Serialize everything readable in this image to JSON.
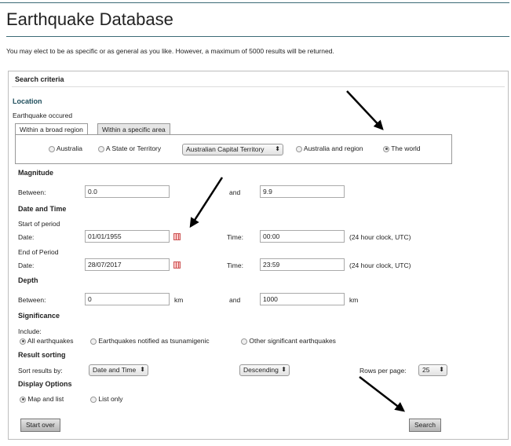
{
  "page": {
    "title": "Earthquake Database",
    "intro": "You may elect to be as specific or as general as you like. However, a maximum of 5000 results will be returned."
  },
  "form": {
    "panel_title": "Search criteria",
    "location": {
      "heading": "Location",
      "occurred_label": "Earthquake occured",
      "tabs": [
        "Within a broad region",
        "Within a specific area"
      ],
      "options": [
        "Australia",
        "A State or Territory",
        "Australia and region",
        "The world"
      ],
      "state_select": "Australian Capital Territory",
      "selected": "The world"
    },
    "magnitude": {
      "heading": "Magnitude",
      "between_label": "Between:",
      "min": "0.0",
      "and_label": "and",
      "max": "9.9"
    },
    "datetime": {
      "heading": "Date and Time",
      "start_label": "Start of period",
      "end_label": "End of Period",
      "date_label": "Date:",
      "time_label": "Time:",
      "start_date": "01/01/1955",
      "start_time": "00:00",
      "end_date": "28/07/2017",
      "end_time": "23:59",
      "time_hint": "(24 hour clock, UTC)"
    },
    "depth": {
      "heading": "Depth",
      "between_label": "Between:",
      "min": "0",
      "unit": "km",
      "and_label": "and",
      "max": "1000"
    },
    "significance": {
      "heading": "Significance",
      "include_label": "Include:",
      "options": [
        "All earthquakes",
        "Earthquakes notified as tsunamigenic",
        "Other significant earthquakes"
      ],
      "selected": "All earthquakes"
    },
    "sorting": {
      "heading": "Result sorting",
      "sort_label": "Sort results by:",
      "sort_by": "Date and Time",
      "order": "Descending",
      "rows_label": "Rows per page:",
      "rows": "25"
    },
    "display": {
      "heading": "Display Options",
      "options": [
        "Map and list",
        "List only"
      ],
      "selected": "Map and list"
    },
    "buttons": {
      "start_over": "Start over",
      "search": "Search"
    }
  },
  "colors": {
    "accent": "#3c6b77",
    "heading_teal": "#1f4e5c"
  }
}
